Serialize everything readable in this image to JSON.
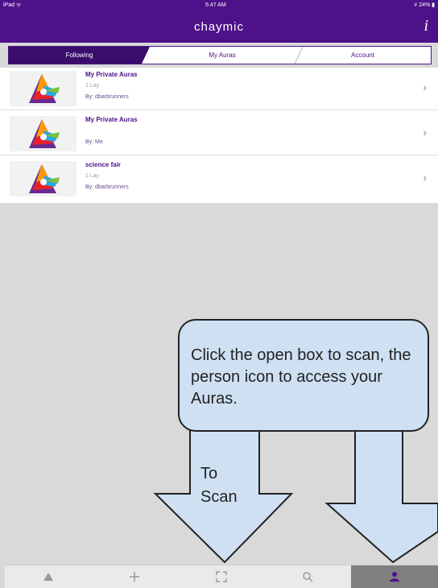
{
  "status_bar": {
    "carrier": "iPad ᯤ",
    "time": "5:47 AM",
    "battery": "≠ 24% ▮"
  },
  "nav": {
    "title": "chaymic",
    "info_icon": "info-icon"
  },
  "tabs": [
    {
      "label": "Following",
      "active": true
    },
    {
      "label": "My Auras",
      "active": false
    },
    {
      "label": "Account",
      "active": false
    }
  ],
  "auras": [
    {
      "title": "My Private Auras",
      "subtitle": "1 Lay",
      "by": "By: dbarbrunners"
    },
    {
      "title": "My Private Auras",
      "subtitle": "",
      "by": "By: Me"
    },
    {
      "title": "science fair",
      "subtitle": "1 Lay",
      "by": "By: dbarbrunners"
    }
  ],
  "callout": {
    "text": "Click the open box to scan, the person icon to access your Auras."
  },
  "arrow_label": {
    "line1": "To",
    "line2": "Scan"
  },
  "tab_bar": {
    "items": [
      "home-triangle-icon",
      "add-icon",
      "scan-box-icon",
      "search-icon",
      "person-icon"
    ],
    "active_index": 4
  },
  "colors": {
    "brand": "#4d1289",
    "callout_fill": "#cfe0f3",
    "tab_active": "#7f7f7f"
  }
}
